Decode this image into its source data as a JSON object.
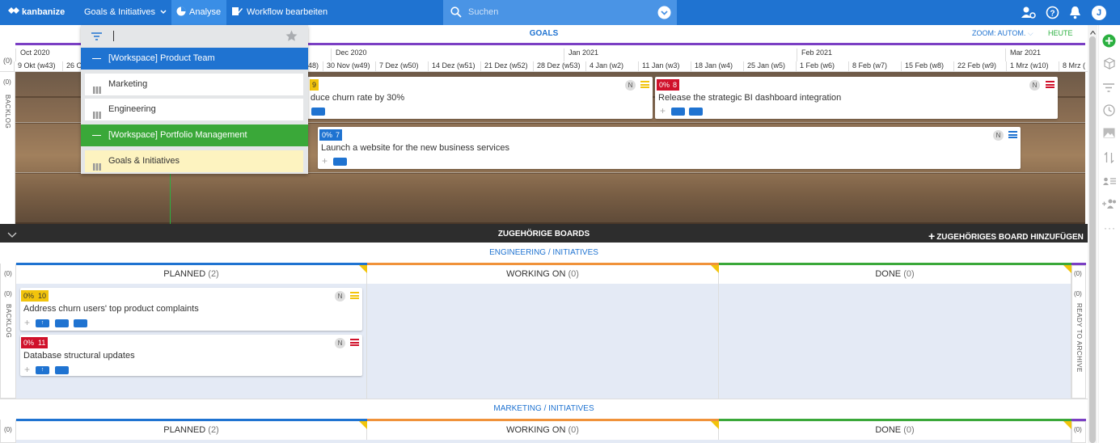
{
  "topbar": {
    "logo": "kanbanize",
    "nav_goals": "Goals & Initiatives",
    "nav_analyse": "Analyse",
    "nav_workflow": "Workflow bearbeiten",
    "search_placeholder": "Suchen",
    "avatar": "J"
  },
  "goals": {
    "title": "GOALS",
    "zoom": "ZOOM: AUTOM.",
    "today": "HEUTE",
    "lane_label": "BACKLOG",
    "lane_count": "(0)",
    "row_count": "(0)"
  },
  "timeline": {
    "months": [
      "Oct 2020",
      "Dec 2020",
      "Jan 2021",
      "Feb 2021",
      "Mar 2021"
    ],
    "weeks": [
      "9 Okt (w43)",
      "26 O",
      "48)",
      "30 Nov (w49)",
      "7 Dez (w50)",
      "14 Dez (w51)",
      "21 Dez (w52)",
      "28 Dez (w53)",
      "4 Jan (w2)",
      "11 Jan (w3)",
      "18 Jan (w4)",
      "25 Jan (w5)",
      "1 Feb (w6)",
      "8 Feb (w7)",
      "15 Feb (w8)",
      "22 Feb (w9)",
      "1 Mrz (w10)",
      "8 Mrz ("
    ]
  },
  "goal_cards": [
    {
      "pct": "",
      "id": "9",
      "title": "duce churn rate by 30%",
      "n": "N"
    },
    {
      "pct": "0%",
      "id": "8",
      "title": "Release the strategic BI dashboard integration",
      "n": "N"
    },
    {
      "pct": "0%",
      "id": "7",
      "title": "Launch a website for the new business services",
      "n": "N"
    }
  ],
  "dropdown": {
    "items": [
      {
        "label": "[Workspace] Product Team"
      },
      {
        "label": "Marketing"
      },
      {
        "label": "Engineering"
      },
      {
        "label": "[Workspace] Portfolio Management"
      },
      {
        "label": "Goals & Initiatives"
      }
    ]
  },
  "related": {
    "title": "ZUGEHÖRIGE BOARDS",
    "add": "ZUGEHÖRIGES BOARD HINZUFÜGEN"
  },
  "boards": [
    {
      "title": "ENGINEERING / INITIATIVES",
      "columns": [
        {
          "name": "PLANNED",
          "count": "(2)"
        },
        {
          "name": "WORKING ON",
          "count": "(0)"
        },
        {
          "name": "DONE",
          "count": "(0)"
        }
      ],
      "left_count": "(0)",
      "right_count": "(0)",
      "lane_count": "(0)",
      "lane_label": "BACKLOG",
      "archive_count": "(0)",
      "archive_label": "READY TO ARCHIVE",
      "cards": [
        {
          "pct": "0%",
          "id": "10",
          "title": "Address churn users' top product complaints",
          "n": "N"
        },
        {
          "pct": "0%",
          "id": "11",
          "title": "Database structural updates",
          "n": "N"
        }
      ]
    },
    {
      "title": "MARKETING / INITIATIVES",
      "columns": [
        {
          "name": "PLANNED",
          "count": "(2)"
        },
        {
          "name": "WORKING ON",
          "count": "(0)"
        },
        {
          "name": "DONE",
          "count": "(0)"
        }
      ],
      "left_count": "(0)",
      "right_count": "(0)"
    }
  ],
  "colors": {
    "brand": "#1f73d1",
    "yellow": "#f2c40c",
    "red": "#d0112b",
    "green": "#3aa839",
    "orange": "#f0923a",
    "purple": "#7b3fc4"
  }
}
